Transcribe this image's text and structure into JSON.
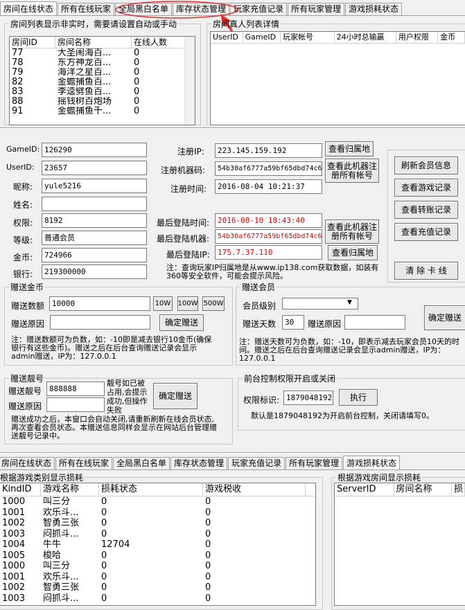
{
  "top_tabs": [
    {
      "label": "房间在线状态"
    },
    {
      "label": "所有在线玩家"
    },
    {
      "label": "全局黑白名单"
    },
    {
      "label": "库存状态管理"
    },
    {
      "label": "玩家充值记录"
    },
    {
      "label": "所有玩家管理"
    },
    {
      "label": "游戏损耗状态"
    }
  ],
  "room_group": {
    "title": "房间列表显示非实时，需要请设置自动或手动",
    "columns": [
      "房间ID",
      "房间名称",
      "在线人数"
    ],
    "rows": [
      [
        "77",
        "大圣闹海百...",
        "0"
      ],
      [
        "78",
        "东方神龙百...",
        "0"
      ],
      [
        "79",
        "海洋之星百...",
        "0"
      ],
      [
        "82",
        "金蟾捕鱼百...",
        "0"
      ],
      [
        "83",
        "李逵劈鱼百...",
        "0"
      ],
      [
        "88",
        "摇钱树百炮场",
        "0"
      ],
      [
        "91",
        "金蟾捕鱼千...",
        "0"
      ]
    ]
  },
  "players_group": {
    "title": "房间真人列表详情",
    "columns": [
      "UserID",
      "GameID",
      "玩家帐号",
      "24小时总输赢",
      "用户权限",
      "金币"
    ]
  },
  "user": {
    "gameid_label": "GameID:",
    "gameid": "126290",
    "userid_label": "UserID:",
    "userid": "23657",
    "nick_label": "昵称:",
    "nick": "yule5216",
    "name_label": "姓名:",
    "name": "",
    "perm_label": "权限:",
    "perm": "8192",
    "level_label": "等级:",
    "level": "普通会员",
    "gold_label": "金币:",
    "gold": "724966",
    "bank_label": "银行:",
    "bank": "219300000",
    "reg_ip_label": "注册IP:",
    "reg_ip": "223.145.159.192",
    "reg_mc_label": "注册机器码:",
    "reg_mc": "54b30af6777a59bf65dbd74c6",
    "reg_time_label": "注册时间:",
    "reg_time": "2016-08-04 10:21:37",
    "last_time_label": "最后登陆时间:",
    "last_time": "2016-08-10 18:43:40",
    "last_mc_label": "最后登陆机器:",
    "last_mc": "54b30af6777a59bf65dbd74c6",
    "last_ip_label": "最后登陆IP:",
    "last_ip": "175.7.37.110",
    "btn_ip_home": "查看归属地",
    "btn_mc_acc": "查看此机器注册所有帐号",
    "btn_last_mc": "查看此机器注册所有帐号",
    "btn_last_ip": "查看归属地",
    "ip_note": "注：查询玩家IP归属地是从www.ip138.com获取数据，如装有360等安全软件，可能会提示风险。"
  },
  "right_buttons": [
    "刷新会员信息",
    "查看游戏记录",
    "查看转账记录",
    "查看充值记录",
    "清 除 卡 线"
  ],
  "gift_gold": {
    "title": "赠送金币",
    "amount_label": "赠送数额",
    "amount": "10000",
    "reason_label": "赠送原因",
    "reason": "",
    "b10": "10W",
    "b100": "100W",
    "b500": "500W",
    "confirm": "确定赠送",
    "note": "注：赠送数额可为负数，如：-10即是减去银行10金币(确保银行有这些金币)。赠送之后在后台查询赠送记录会显示admin赠送，IP为：127.0.0.1"
  },
  "gift_vip": {
    "title": "赠送会员",
    "level_label": "会员级别",
    "level": "",
    "days_label": "赠送天数",
    "days": "30",
    "reason_label": "赠送原因",
    "reason": "",
    "confirm": "确定赠送",
    "note": "注：赠送天数可为负数，如：-10，即表示减去玩家会员10天的时间。赠送之后在后台查询赠送记录会显示admin赠送，IP为：127.0.0.1"
  },
  "gift_num": {
    "title": "赠送靓号",
    "num_label": "赠送靓号",
    "num": "888888",
    "reason_label": "赠送原因",
    "reason": "",
    "tip": "靓号如已被占用,会提示成功,但操作失败",
    "confirm": "确定赠送",
    "note": "赠送成功之后，本窗口会自动关闭,请重新刷新在线会员状态,再次查看会员状态。本赠送信息同样会显示在网站后台管理赠送靓号记录中。"
  },
  "perm_ctrl": {
    "title": "前台控制权限开启或关闭",
    "label": "权限标识:",
    "value": "1879048192",
    "exec": "执行",
    "note": "默认是1879048192为开启前台控制，关闭请填写0。"
  },
  "bottom_tabs": [
    {
      "label": "房间在线状态"
    },
    {
      "label": "所有在线玩家"
    },
    {
      "label": "全局黑白名单"
    },
    {
      "label": "库存状态管理"
    },
    {
      "label": "玩家充值记录"
    },
    {
      "label": "所有玩家管理"
    },
    {
      "label": "游戏损耗状态"
    }
  ],
  "loss_kind": {
    "title": "根据游戏类别显示损耗",
    "columns": [
      "KindID",
      "游戏名称",
      "损耗状态",
      "游戏税收"
    ],
    "rows": [
      [
        "1000",
        "叫三分",
        "0",
        "0"
      ],
      [
        "1001",
        "欢乐斗...",
        "0",
        "0"
      ],
      [
        "1002",
        "智勇三张",
        "0",
        "0"
      ],
      [
        "1003",
        "闷抓斗...",
        "0",
        "0"
      ],
      [
        "1004",
        "牛牛",
        "12704",
        "0"
      ],
      [
        "1005",
        "梭哈",
        "0",
        "0"
      ],
      [
        "1000",
        "叫三分",
        "0",
        "0"
      ],
      [
        "1001",
        "欢乐斗...",
        "0",
        "0"
      ],
      [
        "1002",
        "智勇三张",
        "0",
        "0"
      ],
      [
        "1003",
        "闷抓斗...",
        "0",
        "0"
      ]
    ]
  },
  "loss_room": {
    "title": "根据游戏房间显示损耗",
    "columns": [
      "ServerID",
      "房间名称",
      "损"
    ]
  }
}
